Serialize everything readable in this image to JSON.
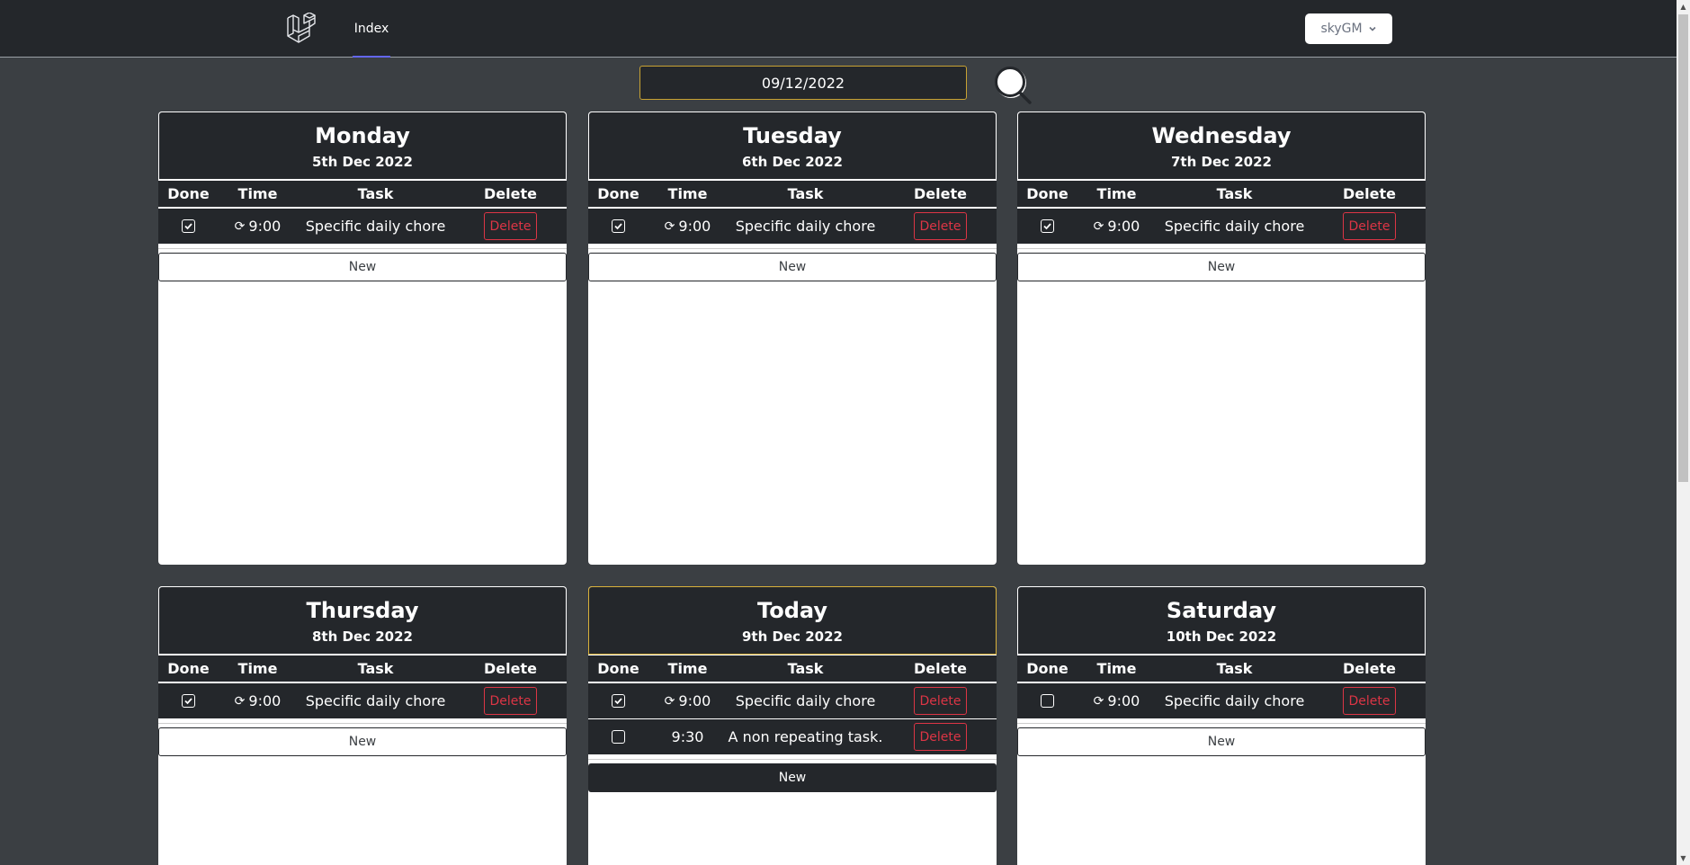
{
  "nav": {
    "link_label": "Index",
    "user_label": "skyGM"
  },
  "search": {
    "date_value": "09/12/2022"
  },
  "table_headers": {
    "done": "Done",
    "time": "Time",
    "task": "Task",
    "delete": "Delete"
  },
  "labels": {
    "delete": "Delete",
    "new": "New",
    "repeat_glyph": "⟳"
  },
  "days": [
    {
      "name": "Monday",
      "date": "5th Dec 2022",
      "today": false,
      "tasks": [
        {
          "done": true,
          "repeating": true,
          "time": "9:00",
          "task": "Specific daily chore"
        }
      ]
    },
    {
      "name": "Tuesday",
      "date": "6th Dec 2022",
      "today": false,
      "tasks": [
        {
          "done": true,
          "repeating": true,
          "time": "9:00",
          "task": "Specific daily chore"
        }
      ]
    },
    {
      "name": "Wednesday",
      "date": "7th Dec 2022",
      "today": false,
      "tasks": [
        {
          "done": true,
          "repeating": true,
          "time": "9:00",
          "task": "Specific daily chore"
        }
      ]
    },
    {
      "name": "Thursday",
      "date": "8th Dec 2022",
      "today": false,
      "tasks": [
        {
          "done": true,
          "repeating": true,
          "time": "9:00",
          "task": "Specific daily chore"
        }
      ]
    },
    {
      "name": "Today",
      "date": "9th Dec 2022",
      "today": true,
      "tasks": [
        {
          "done": true,
          "repeating": true,
          "time": "9:00",
          "task": "Specific daily chore"
        },
        {
          "done": false,
          "repeating": false,
          "time": "9:30",
          "task": "A non repeating task."
        }
      ]
    },
    {
      "name": "Saturday",
      "date": "10th Dec 2022",
      "today": false,
      "tasks": [
        {
          "done": false,
          "repeating": true,
          "time": "9:00",
          "task": "Specific daily chore"
        }
      ]
    }
  ],
  "colors": {
    "background": "#3b3f43",
    "panel": "#24272b",
    "accent_gold": "#c8a232",
    "danger": "#dc3545",
    "nav_underline": "#6366f1"
  },
  "icons": {
    "logo": "laravel-logo-icon",
    "search": "search-icon",
    "chevron": "chevron-down-icon",
    "check": "check-icon",
    "repeat": "repeat-icon"
  }
}
